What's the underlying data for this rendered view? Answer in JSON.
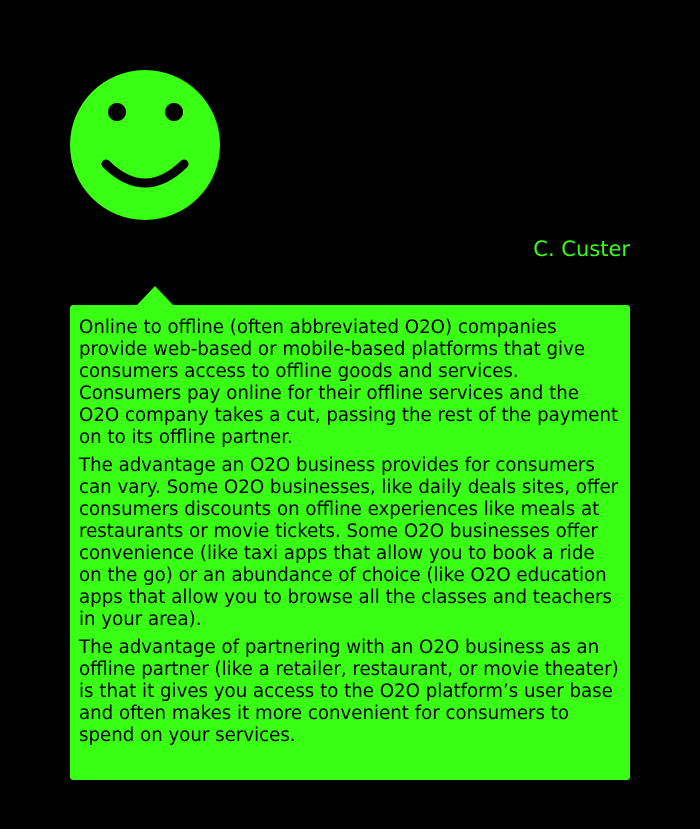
{
  "theme": {
    "background": "#000000",
    "accent": "#39ff14",
    "text_on_accent": "#000000"
  },
  "avatar": {
    "icon": "smiley-face-icon"
  },
  "author": {
    "name": "C. Custer"
  },
  "bubble": {
    "paragraphs": [
      "Online to offline (often abbreviated O2O) companies provide web-based or mobile-based platforms that give consumers access to offline goods and services. Consumers pay online for their offline services and the O2O company takes a cut, passing the rest of the payment on to its offline partner.",
      "The advantage an O2O business provides for consumers can vary. Some O2O businesses, like daily deals sites, offer consumers discounts on offline experiences like meals at restaurants or movie tickets. Some O2O businesses offer convenience (like taxi apps that allow you to book a ride on the go) or an abundance of choice (like O2O education apps that allow you to browse all the classes and teachers in your area).",
      "The advantage of partnering with an O2O business as an offline partner (like a retailer, restaurant, or movie theater) is that it gives you access to the O2O platform’s user base and often makes it more convenient for consumers to spend on your services."
    ]
  }
}
